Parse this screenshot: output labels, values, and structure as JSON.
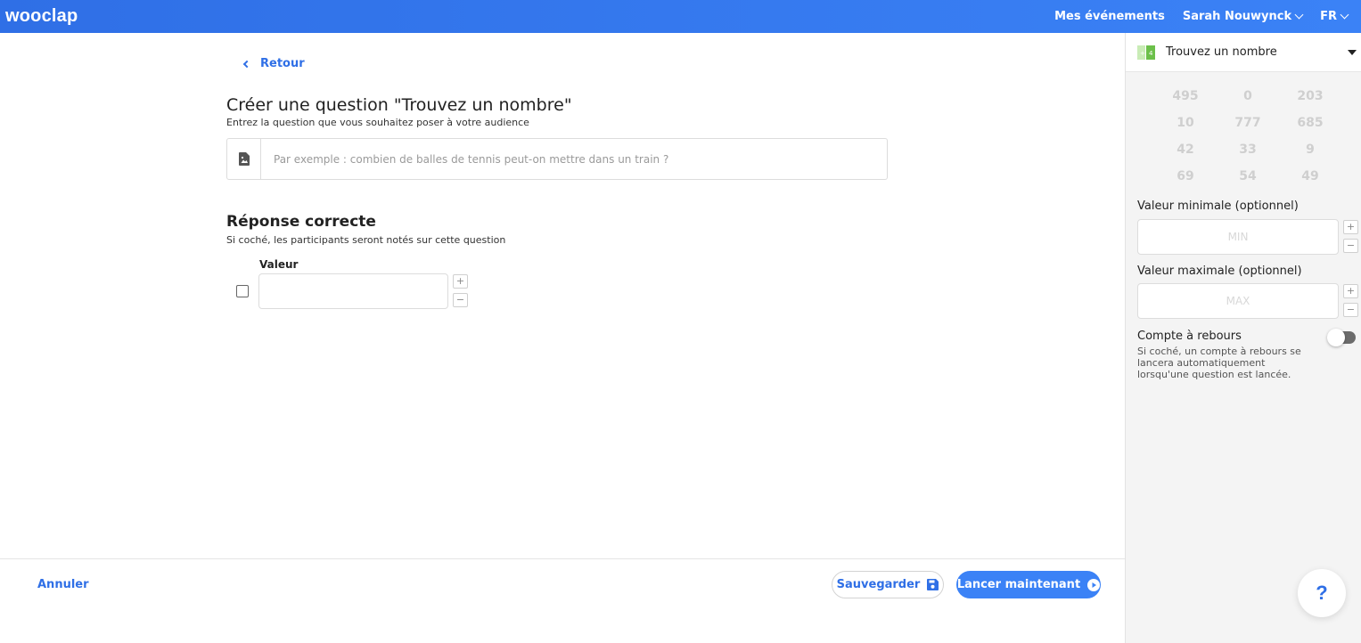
{
  "app": {
    "logo": "wooclap"
  },
  "topnav": {
    "events": "Mes événements",
    "user": "Sarah Nouwynck",
    "lang": "FR"
  },
  "main": {
    "back": "Retour",
    "title": "Créer une question \"Trouvez un nombre\"",
    "subtitle": "Entrez la question que vous souhaitez poser à votre audience",
    "question_placeholder": "Par exemple : combien de balles de tennis peut-on mettre dans un train ?",
    "answer_title": "Réponse correcte",
    "answer_subtitle": "Si coché, les participants seront notés sur cette question",
    "value_label": "Valeur",
    "plus": "+",
    "minus": "−"
  },
  "footer": {
    "cancel": "Annuler",
    "save": "Sauvegarder",
    "launch": "Lancer maintenant"
  },
  "sidebar": {
    "type_label": "Trouvez un nombre",
    "numbers": [
      "495",
      "0",
      "203",
      "10",
      "777",
      "685",
      "42",
      "33",
      "9",
      "69",
      "54",
      "49"
    ],
    "min_label": "Valeur minimale (optionnel)",
    "min_placeholder": "MIN",
    "max_label": "Valeur maximale (optionnel)",
    "max_placeholder": "MAX",
    "countdown_title": "Compte à rebours",
    "countdown_desc": "Si coché, un compte à rebours se lancera automatiquement lorsqu'une question est lancée.",
    "plus": "+",
    "minus": "−"
  },
  "help": {
    "label": "?"
  },
  "colors": {
    "accent": "#3b82f6",
    "accent_dark": "#2f6fe6",
    "sidebar_bg": "#f4f4f4",
    "number_gray": "#cfcfcf",
    "icon_green": "#6cc04a"
  }
}
